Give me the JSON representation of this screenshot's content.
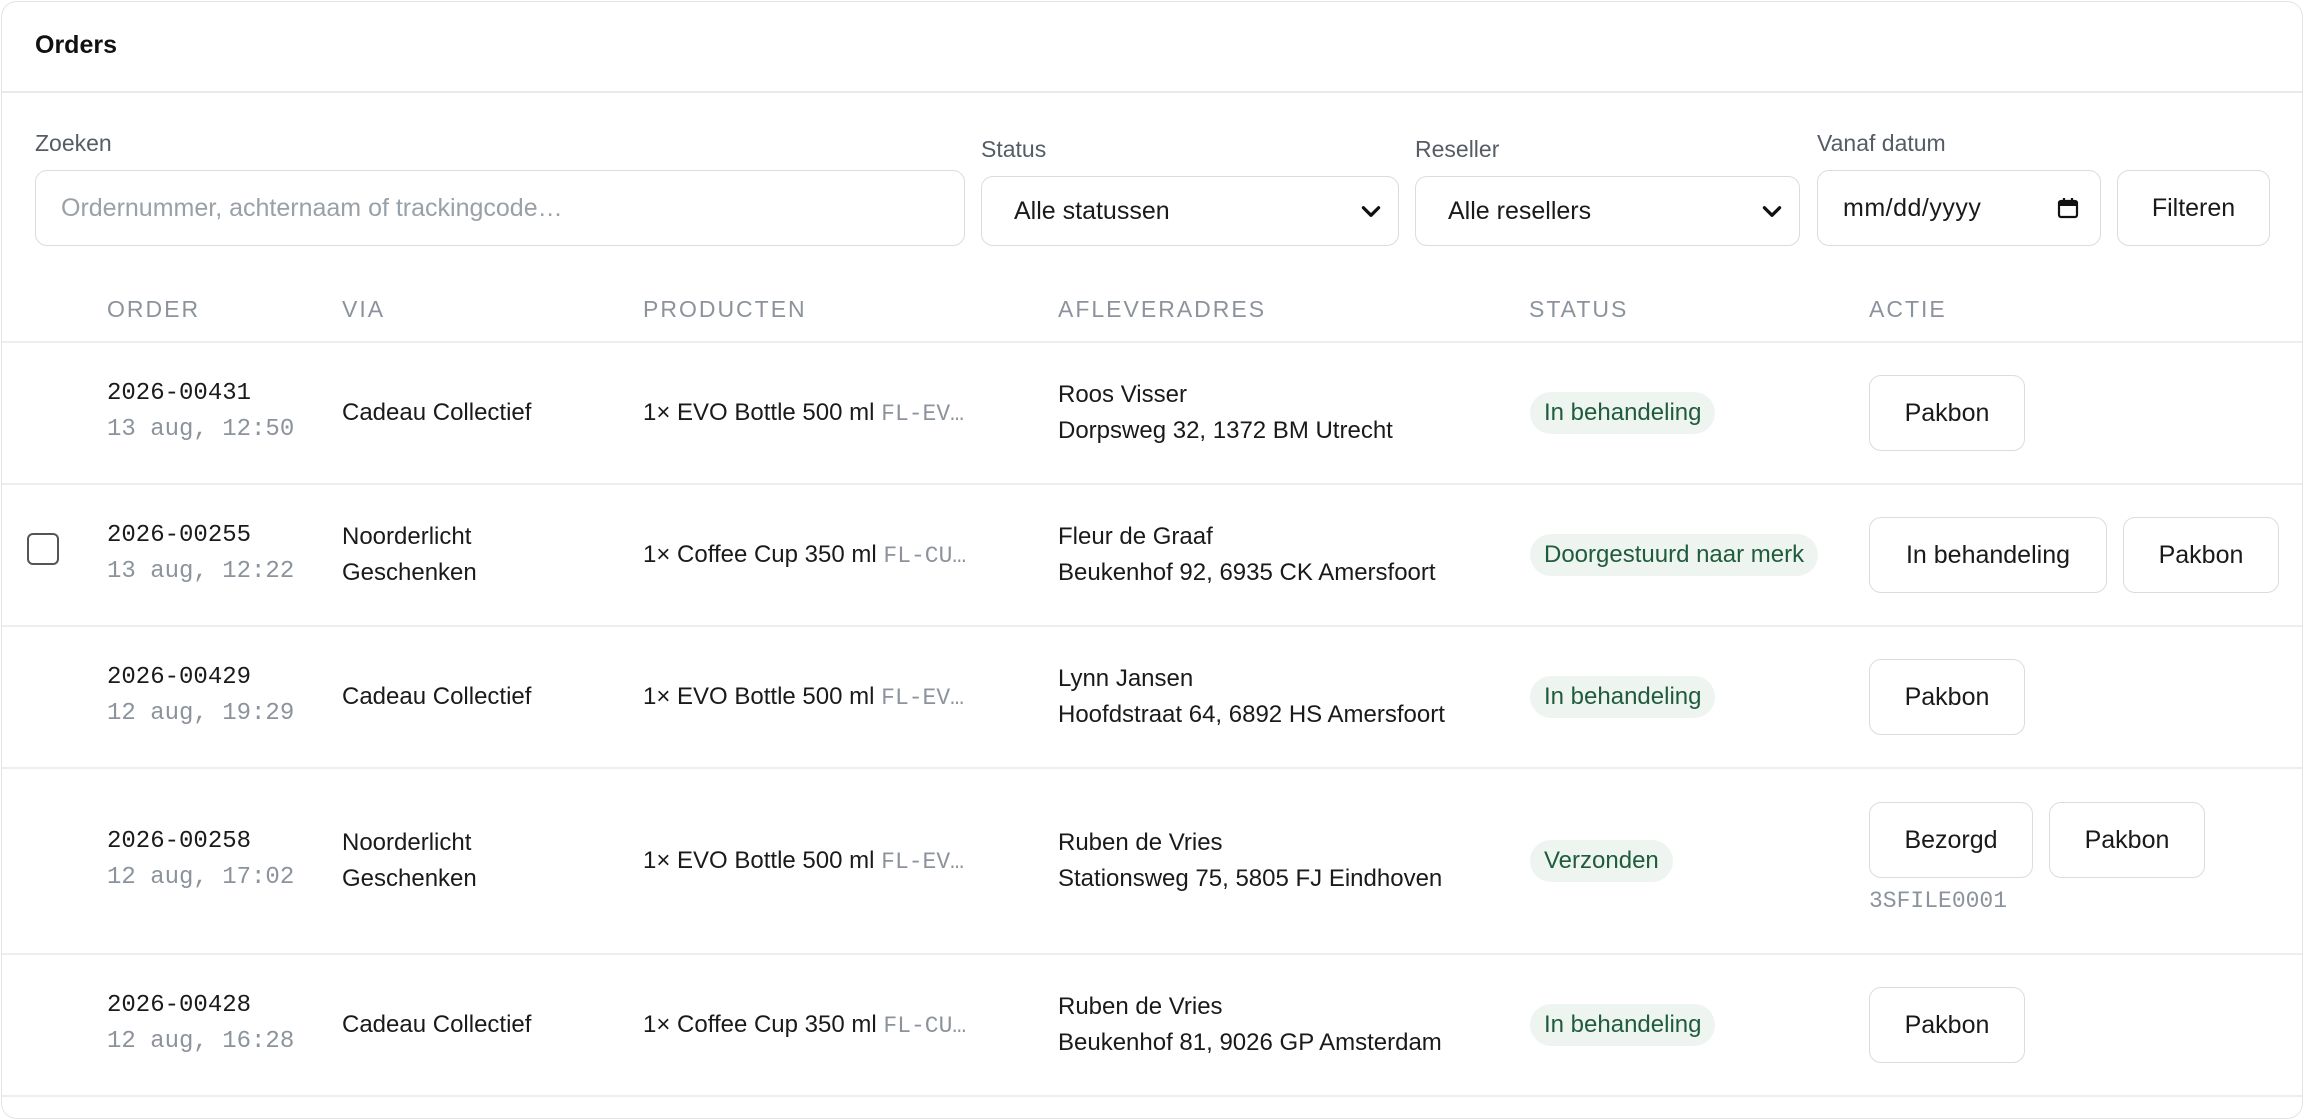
{
  "panel": {
    "title": "Orders"
  },
  "filters": {
    "search_label": "Zoeken",
    "search_placeholder": "Ordernummer, achternaam of trackingcode…",
    "status_label": "Status",
    "status_value": "Alle statussen",
    "reseller_label": "Reseller",
    "reseller_value": "Alle resellers",
    "date_label": "Vanaf datum",
    "date_value": "mm/dd/yyyy",
    "filter_button": "Filteren"
  },
  "table": {
    "headers": [
      "Order",
      "Via",
      "Producten",
      "Afleveradres",
      "Status",
      "Actie"
    ],
    "rows": [
      {
        "order": "2026-00431",
        "date": "13 aug, 12:50",
        "via": [
          "Cadeau Collectief"
        ],
        "product": "1× EVO Bottle 500 ml",
        "sku": "FL-EV…",
        "name": "Roos Visser",
        "address": "Dorpsweg 32, 1372 BM Utrecht",
        "status": "In behandeling",
        "actions": [
          "Pakbon"
        ]
      },
      {
        "order": "2026-00255",
        "date": "13 aug, 12:22",
        "via": [
          "Noorderlicht",
          "Geschenken"
        ],
        "product": "1× Coffee Cup 350 ml",
        "sku": "FL-CU…",
        "name": "Fleur de Graaf",
        "address": "Beukenhof 92, 6935 CK Amersfoort",
        "status": "Doorgestuurd naar merk",
        "actions": [
          "In behandeling",
          "Pakbon"
        ]
      },
      {
        "order": "2026-00429",
        "date": "12 aug, 19:29",
        "via": [
          "Cadeau Collectief"
        ],
        "product": "1× EVO Bottle 500 ml",
        "sku": "FL-EV…",
        "name": "Lynn Jansen",
        "address": "Hoofdstraat 64, 6892 HS Amersfoort",
        "status": "In behandeling",
        "actions": [
          "Pakbon"
        ]
      },
      {
        "order": "2026-00258",
        "date": "12 aug, 17:02",
        "via": [
          "Noorderlicht",
          "Geschenken"
        ],
        "product": "1× EVO Bottle 500 ml",
        "sku": "FL-EV…",
        "name": "Ruben de Vries",
        "address": "Stationsweg 75, 5805 FJ Eindhoven",
        "status": "Verzonden",
        "actions": [
          "Bezorgd",
          "Pakbon"
        ],
        "tracking": "3SFILE0001"
      },
      {
        "order": "2026-00428",
        "date": "12 aug, 16:28",
        "via": [
          "Cadeau Collectief"
        ],
        "product": "1× Coffee Cup 350 ml",
        "sku": "FL-CU…",
        "name": "Ruben de Vries",
        "address": "Beukenhof 81, 9026 GP Amsterdam",
        "status": "In behandeling",
        "actions": [
          "Pakbon"
        ]
      }
    ]
  },
  "colors": {
    "badge_bg": "#eef4f0",
    "badge_text": "#1f5c3c",
    "border": "#d9dce1"
  }
}
